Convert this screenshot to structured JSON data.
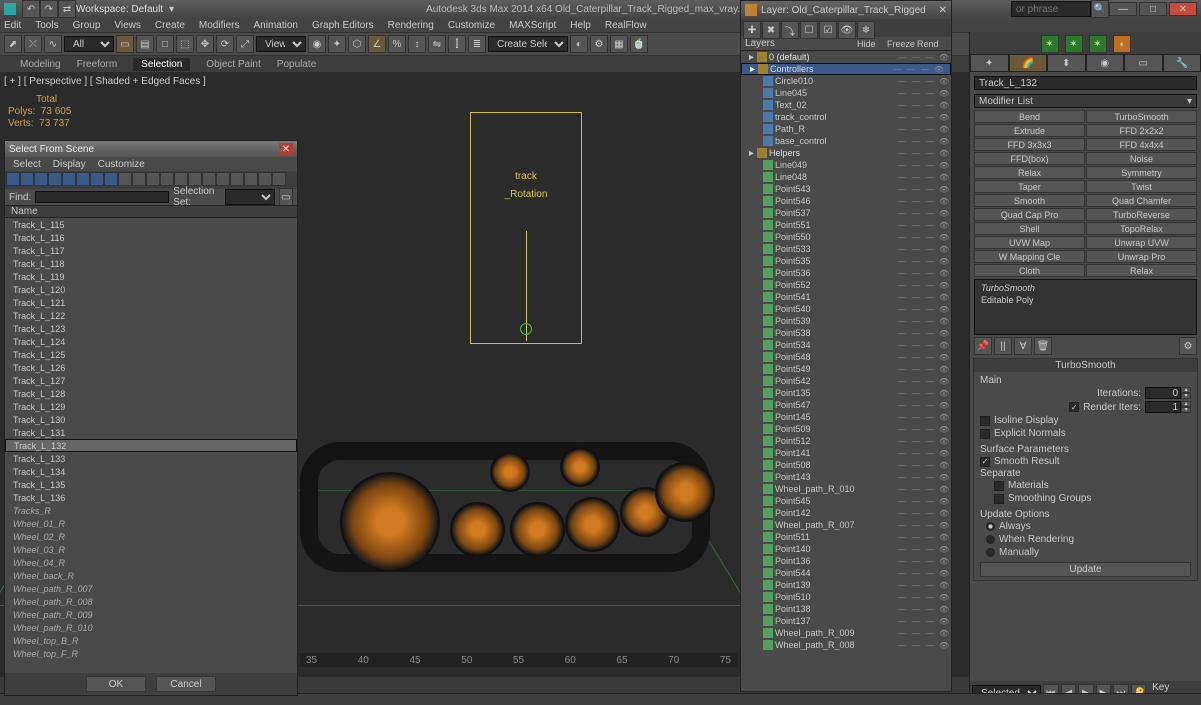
{
  "app": {
    "workspace_label": "Workspace: Default",
    "title_center": "Autodesk 3ds Max 2014 x64   Old_Caterpillar_Track_Rigged_max_vray.max",
    "search_placeholder": "or phrase"
  },
  "menu": [
    "Edit",
    "Tools",
    "Group",
    "Views",
    "Create",
    "Modifiers",
    "Animation",
    "Graph Editors",
    "Rendering",
    "Customize",
    "MAXScript",
    "Help",
    "RealFlow"
  ],
  "toolbar": {
    "all_label": "All",
    "view_label": "View",
    "create_sel_label": "Create Selection S"
  },
  "ribbon": [
    "Modeling",
    "Freeform",
    "Selection",
    "Object Paint",
    "Populate"
  ],
  "ribbon_active": 2,
  "viewport": {
    "label": "[ + ] [ Perspective ] [ Shaded + Edged Faces ]",
    "stats_head": "Total",
    "polys_label": "Polys:",
    "polys": "73 605",
    "verts_label": "Verts:",
    "verts": "73 737",
    "helper_line1": "track",
    "helper_line2": "_Rotation"
  },
  "timeline_ticks": [
    "35",
    "40",
    "45",
    "50",
    "55",
    "60",
    "65",
    "70",
    "75"
  ],
  "select_from_scene": {
    "title": "Select From Scene",
    "menu": [
      "Select",
      "Display",
      "Customize"
    ],
    "find_label": "Find:",
    "selset_label": "Selection Set:",
    "name_header": "Name",
    "ok": "OK",
    "cancel": "Cancel",
    "selected_index": 22,
    "items": [
      "Track_L_115",
      "Track_L_116",
      "Track_L_117",
      "Track_L_118",
      "Track_L_119",
      "Track_L_120",
      "Track_L_121",
      "Track_L_122",
      "Track_L_123",
      "Track_L_124",
      "Track_L_125",
      "Track_L_126",
      "Track_L_127",
      "Track_L_128",
      "Track_L_129",
      "Track_L_130",
      "Track_L_131",
      "Track_L_132",
      "Track_L_133",
      "Track_L_134",
      "Track_L_135",
      "Track_L_136",
      "Tracks_R",
      "Wheel_01_R",
      "Wheel_02_R",
      "Wheel_03_R",
      "Wheel_04_R",
      "Wheel_back_R",
      "Wheel_path_R_007",
      "Wheel_path_R_008",
      "Wheel_path_R_009",
      "Wheel_path_R_010",
      "Wheel_top_B_R",
      "Wheel_top_F_R"
    ],
    "italic_from": 22
  },
  "layer_dialog": {
    "title": "Layer: Old_Caterpillar_Track_Rigged",
    "header_layers": "Layers",
    "col_hide": "Hide",
    "col_freeze": "Freeze",
    "col_render": "Rend",
    "items": [
      {
        "depth": 0,
        "type": "layer",
        "name": "0 (default)"
      },
      {
        "depth": 0,
        "type": "layer",
        "name": "Controllers",
        "sel": true
      },
      {
        "depth": 1,
        "type": "shape",
        "name": "Circle010"
      },
      {
        "depth": 1,
        "type": "shape",
        "name": "Line045"
      },
      {
        "depth": 1,
        "type": "shape",
        "name": "Text_02"
      },
      {
        "depth": 1,
        "type": "shape",
        "name": "track_control"
      },
      {
        "depth": 1,
        "type": "shape",
        "name": "Path_R"
      },
      {
        "depth": 1,
        "type": "shape",
        "name": "base_control"
      },
      {
        "depth": 0,
        "type": "layer",
        "name": "Helpers"
      },
      {
        "depth": 1,
        "type": "helper",
        "name": "Line049"
      },
      {
        "depth": 1,
        "type": "helper",
        "name": "Line048"
      },
      {
        "depth": 1,
        "type": "helper",
        "name": "Point543"
      },
      {
        "depth": 1,
        "type": "helper",
        "name": "Point546"
      },
      {
        "depth": 1,
        "type": "helper",
        "name": "Point537"
      },
      {
        "depth": 1,
        "type": "helper",
        "name": "Point551"
      },
      {
        "depth": 1,
        "type": "helper",
        "name": "Point550"
      },
      {
        "depth": 1,
        "type": "helper",
        "name": "Point533"
      },
      {
        "depth": 1,
        "type": "helper",
        "name": "Point535"
      },
      {
        "depth": 1,
        "type": "helper",
        "name": "Point536"
      },
      {
        "depth": 1,
        "type": "helper",
        "name": "Point552"
      },
      {
        "depth": 1,
        "type": "helper",
        "name": "Point541"
      },
      {
        "depth": 1,
        "type": "helper",
        "name": "Point540"
      },
      {
        "depth": 1,
        "type": "helper",
        "name": "Point539"
      },
      {
        "depth": 1,
        "type": "helper",
        "name": "Point538"
      },
      {
        "depth": 1,
        "type": "helper",
        "name": "Point534"
      },
      {
        "depth": 1,
        "type": "helper",
        "name": "Point548"
      },
      {
        "depth": 1,
        "type": "helper",
        "name": "Point549"
      },
      {
        "depth": 1,
        "type": "helper",
        "name": "Point542"
      },
      {
        "depth": 1,
        "type": "helper",
        "name": "Point135"
      },
      {
        "depth": 1,
        "type": "helper",
        "name": "Point547"
      },
      {
        "depth": 1,
        "type": "helper",
        "name": "Point145"
      },
      {
        "depth": 1,
        "type": "helper",
        "name": "Point509"
      },
      {
        "depth": 1,
        "type": "helper",
        "name": "Point512"
      },
      {
        "depth": 1,
        "type": "helper",
        "name": "Point141"
      },
      {
        "depth": 1,
        "type": "helper",
        "name": "Point508"
      },
      {
        "depth": 1,
        "type": "helper",
        "name": "Point143"
      },
      {
        "depth": 1,
        "type": "helper",
        "name": "Wheel_path_R_010"
      },
      {
        "depth": 1,
        "type": "helper",
        "name": "Point545"
      },
      {
        "depth": 1,
        "type": "helper",
        "name": "Point142"
      },
      {
        "depth": 1,
        "type": "helper",
        "name": "Wheel_path_R_007"
      },
      {
        "depth": 1,
        "type": "helper",
        "name": "Point511"
      },
      {
        "depth": 1,
        "type": "helper",
        "name": "Point140"
      },
      {
        "depth": 1,
        "type": "helper",
        "name": "Point136"
      },
      {
        "depth": 1,
        "type": "helper",
        "name": "Point544"
      },
      {
        "depth": 1,
        "type": "helper",
        "name": "Point139"
      },
      {
        "depth": 1,
        "type": "helper",
        "name": "Point510"
      },
      {
        "depth": 1,
        "type": "helper",
        "name": "Point138"
      },
      {
        "depth": 1,
        "type": "helper",
        "name": "Point137"
      },
      {
        "depth": 1,
        "type": "helper",
        "name": "Wheel_path_R_009"
      },
      {
        "depth": 1,
        "type": "helper",
        "name": "Wheel_path_R_008"
      }
    ]
  },
  "command_panel": {
    "object_name": "Track_L_132",
    "modifier_list_label": "Modifier List",
    "modbuttons": [
      "Bend",
      "TurboSmooth",
      "Extrude",
      "FFD 2x2x2",
      "FFD 3x3x3",
      "FFD 4x4x4",
      "FFD(box)",
      "Noise",
      "Relax",
      "Symmetry",
      "Taper",
      "Twist",
      "Smooth",
      "Quad Chamfer",
      "Quad Cap Pro",
      "TurboReverse",
      "Shell",
      "TopoRelax",
      "UVW Map",
      "Unwrap UVW",
      "W Mapping Cle",
      "Unwrap Pro",
      "Cloth",
      "Relax"
    ],
    "stack": [
      "TurboSmooth",
      "Editable Poly"
    ],
    "rollout_title": "TurboSmooth",
    "main_label": "Main",
    "iterations_label": "Iterations:",
    "iterations_value": "0",
    "render_iters_label": "Render Iters:",
    "render_iters_value": "1",
    "isoline_label": "Isoline Display",
    "explicit_label": "Explicit Normals",
    "surface_params": "Surface Parameters",
    "smooth_result": "Smooth Result",
    "separate_label": "Separate",
    "materials_label": "Materials",
    "smoothing_groups_label": "Smoothing Groups",
    "update_options": "Update Options",
    "always_label": "Always",
    "when_rendering_label": "When Rendering",
    "manually_label": "Manually",
    "update_btn": "Update"
  },
  "statusbar": {
    "selected_label": "Selected",
    "keyfilters_label": "Key Filters..."
  }
}
